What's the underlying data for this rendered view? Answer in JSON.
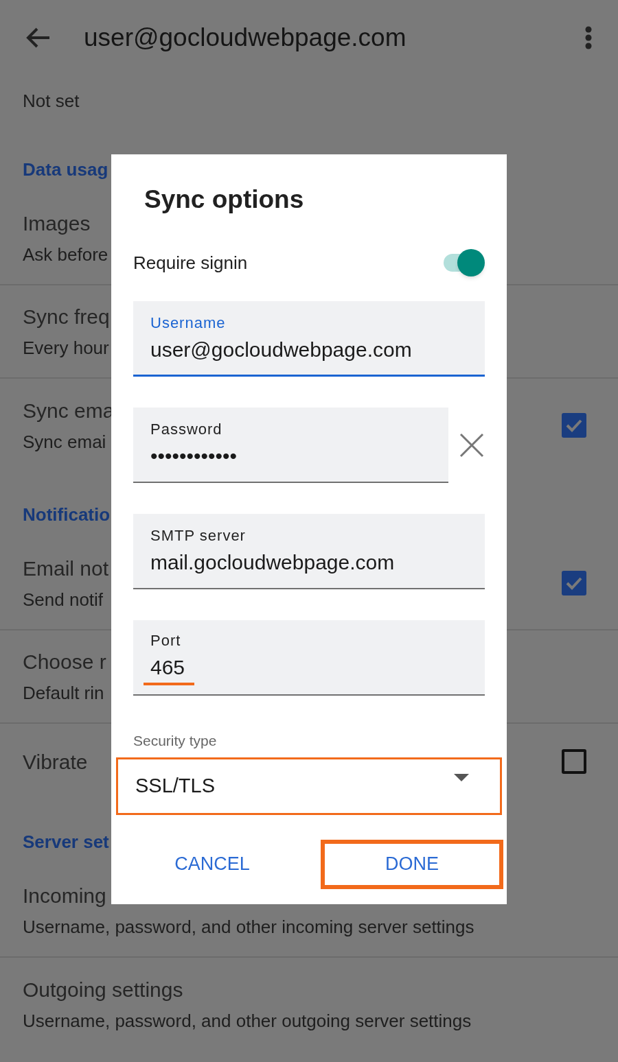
{
  "app_bar": {
    "title": "user@gocloudwebpage.com"
  },
  "settings": [
    {
      "kind": "summary",
      "text": "Not set"
    },
    {
      "kind": "header",
      "text": "Data usag"
    },
    {
      "kind": "item",
      "title": "Images",
      "summary": "Ask before"
    },
    {
      "kind": "item",
      "title": "Sync freq",
      "summary": "Every hour"
    },
    {
      "kind": "item",
      "title": "Sync ema",
      "summary": "Sync emai",
      "checked": true
    },
    {
      "kind": "header",
      "text": "Notificatio"
    },
    {
      "kind": "item",
      "title": "Email not",
      "summary": "Send notif",
      "checked": true
    },
    {
      "kind": "item",
      "title": "Choose r",
      "summary": "Default rin"
    },
    {
      "kind": "item",
      "title": "Vibrate",
      "checked": false
    },
    {
      "kind": "header",
      "text": "Server set"
    },
    {
      "kind": "item",
      "title": "Incoming",
      "summary": "Username, password, and other incoming server settings"
    },
    {
      "kind": "item",
      "title": "Outgoing settings",
      "summary": "Username, password, and other outgoing server settings"
    }
  ],
  "dialog": {
    "title": "Sync options",
    "switch": {
      "label": "Require signin",
      "on": true
    },
    "fields": [
      {
        "label": "Username",
        "value": "user@gocloudwebpage.com",
        "focused": true,
        "clearable": false,
        "highlighted": false
      },
      {
        "label": "Password",
        "value": "••••••••••••",
        "focused": false,
        "clearable": true,
        "highlighted": false
      },
      {
        "label": "SMTP server",
        "value": "mail.gocloudwebpage.com",
        "focused": false,
        "clearable": false,
        "highlighted": false
      },
      {
        "label": "Port",
        "value": "465",
        "focused": false,
        "clearable": false,
        "highlighted": true
      }
    ],
    "security": {
      "label": "Security type",
      "value": "SSL/TLS",
      "highlighted": true
    },
    "buttons": [
      {
        "label": "CANCEL",
        "highlighted": false
      },
      {
        "label": "DONE",
        "highlighted": true
      }
    ]
  }
}
